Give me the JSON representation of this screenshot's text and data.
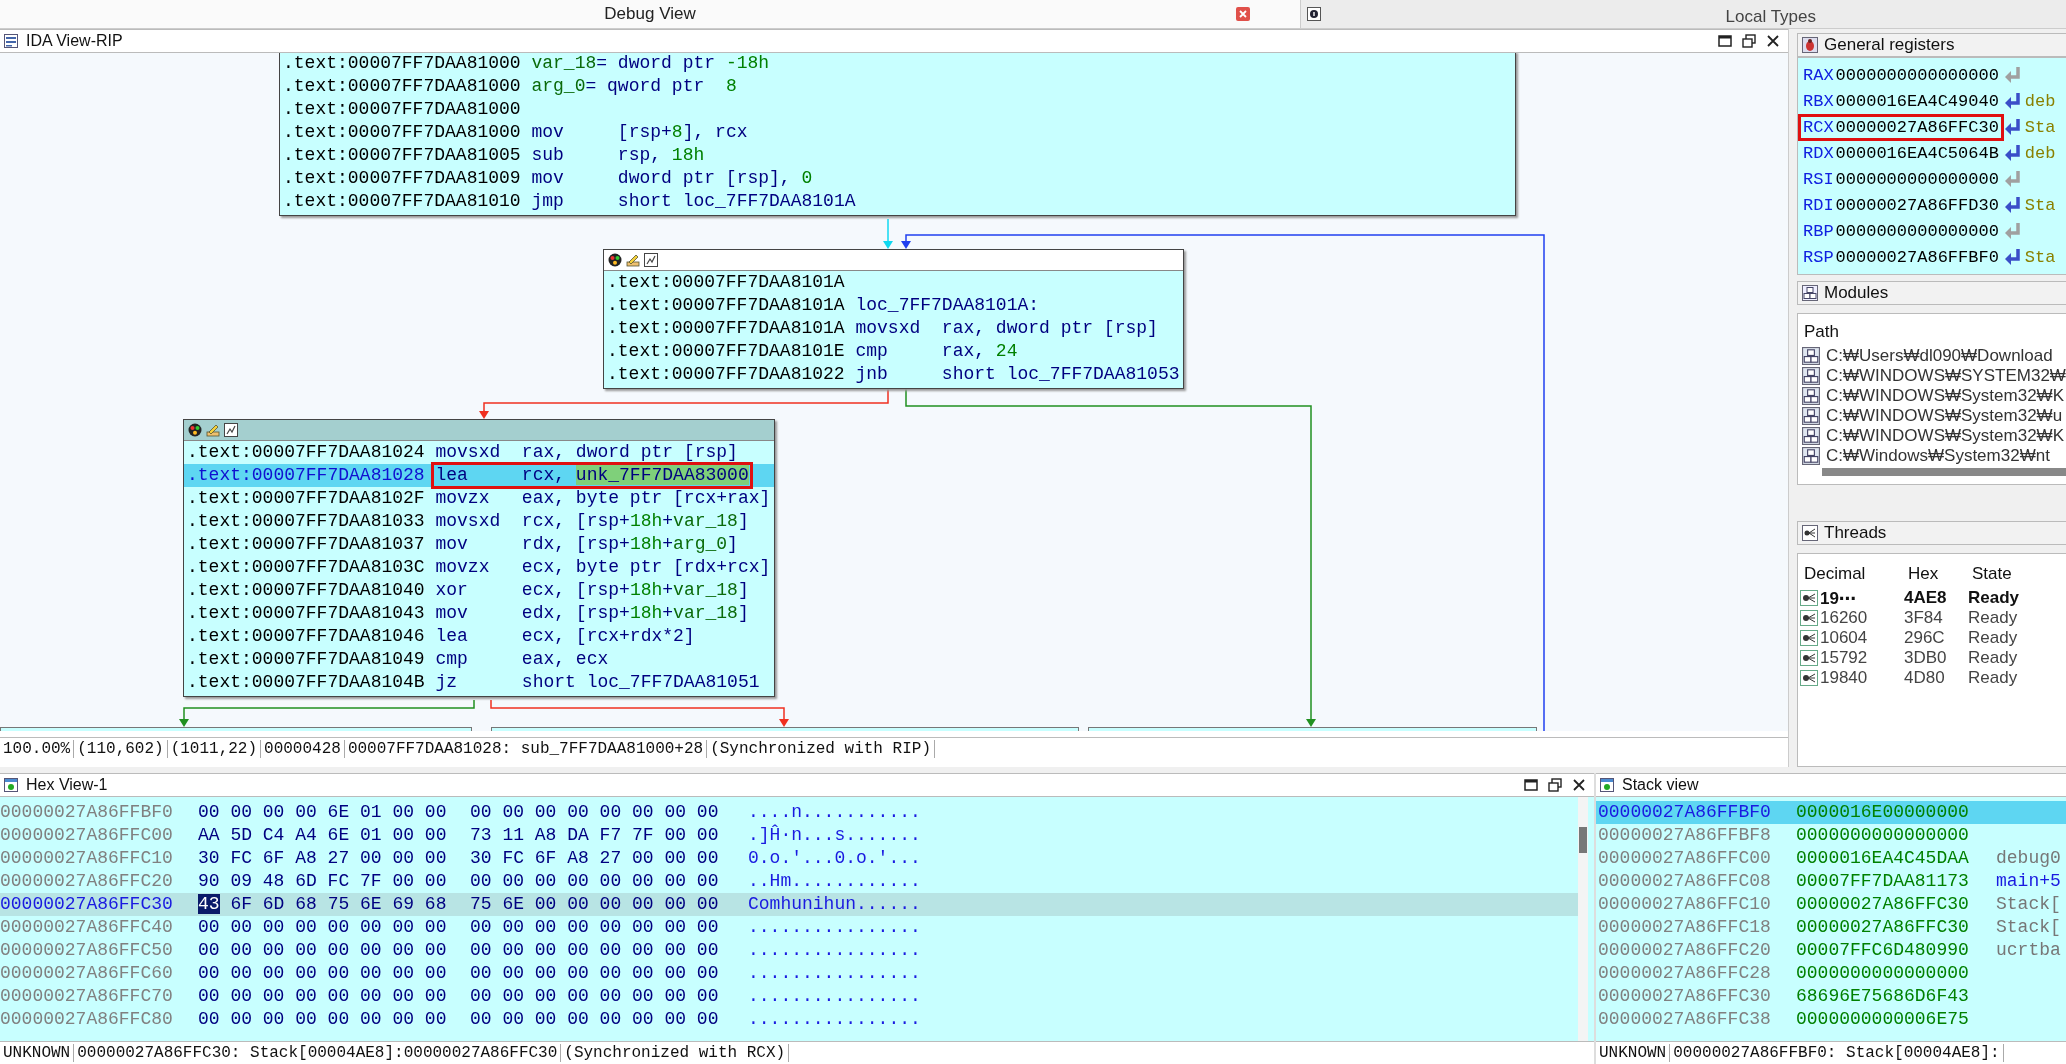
{
  "top_tabs": [
    {
      "label": "Debug View",
      "selected": true
    },
    {
      "label": "Local Types",
      "selected": false
    }
  ],
  "ida_view": {
    "title": "IDA View-RIP",
    "blocks": [
      {
        "header": false,
        "lines": [
          {
            "address": ".text:00007FF7DAA81000",
            "ops": [
              {
                "t": "var_18",
                "kind": "var"
              },
              {
                "t": "= dword ptr ",
                "kind": "op"
              },
              {
                "t": "-18h",
                "kind": "num"
              }
            ],
            "selected": false,
            "boxed": false
          },
          {
            "address": ".text:00007FF7DAA81000",
            "ops": [
              {
                "t": "arg_0",
                "kind": "var"
              },
              {
                "t": "= qword ptr  ",
                "kind": "op"
              },
              {
                "t": "8",
                "kind": "num"
              }
            ],
            "selected": false,
            "boxed": false
          },
          {
            "address": ".text:00007FF7DAA81000",
            "selected": false,
            "boxed": false
          },
          {
            "address": ".text:00007FF7DAA81000",
            "mnemonic": "mov",
            "ops": [
              {
                "t": "[rsp+",
                "kind": "op"
              },
              {
                "t": "8",
                "kind": "num"
              },
              {
                "t": "], rcx",
                "kind": "op"
              }
            ],
            "selected": false,
            "boxed": false
          },
          {
            "address": ".text:00007FF7DAA81005",
            "mnemonic": "sub",
            "ops": [
              {
                "t": "rsp, ",
                "kind": "op"
              },
              {
                "t": "18h",
                "kind": "num"
              }
            ],
            "selected": false,
            "boxed": false
          },
          {
            "address": ".text:00007FF7DAA81009",
            "mnemonic": "mov",
            "ops": [
              {
                "t": "dword ptr [rsp], ",
                "kind": "op"
              },
              {
                "t": "0",
                "kind": "num"
              }
            ],
            "selected": false,
            "boxed": false
          },
          {
            "address": ".text:00007FF7DAA81010",
            "mnemonic": "jmp",
            "ops": [
              {
                "t": "short loc_7FF7DAA8101A",
                "kind": "op"
              }
            ],
            "selected": false,
            "boxed": false
          }
        ]
      },
      {
        "header": true,
        "active": false,
        "lines": [
          {
            "address": ".text:00007FF7DAA8101A",
            "selected": false,
            "boxed": false
          },
          {
            "address": ".text:00007FF7DAA8101A",
            "ops": [
              {
                "t": "loc_7FF7DAA8101A:",
                "kind": "op"
              }
            ],
            "selected": false,
            "boxed": false
          },
          {
            "address": ".text:00007FF7DAA8101A",
            "mnemonic": "movsxd",
            "ops": [
              {
                "t": "rax, dword ptr [rsp]",
                "kind": "op"
              }
            ],
            "selected": false,
            "boxed": false
          },
          {
            "address": ".text:00007FF7DAA8101E",
            "mnemonic": "cmp",
            "ops": [
              {
                "t": "rax, ",
                "kind": "op"
              },
              {
                "t": "24",
                "kind": "num"
              }
            ],
            "selected": false,
            "boxed": false
          },
          {
            "address": ".text:00007FF7DAA81022",
            "mnemonic": "jnb",
            "ops": [
              {
                "t": "short loc_7FF7DAA81053",
                "kind": "op"
              }
            ],
            "selected": false,
            "boxed": false
          }
        ]
      },
      {
        "header": true,
        "active": true,
        "lines": [
          {
            "address": ".text:00007FF7DAA81024",
            "mnemonic": "movsxd",
            "ops": [
              {
                "t": "rax, dword ptr [rsp]",
                "kind": "op"
              }
            ],
            "selected": false,
            "boxed": false
          },
          {
            "address": ".text:00007FF7DAA81028",
            "mnemonic": "lea",
            "ops": [
              {
                "t": "rcx, ",
                "kind": "op"
              },
              {
                "t": "unk_7FF7DAA83000",
                "kind": "hl"
              }
            ],
            "selected": true,
            "boxed": true
          },
          {
            "address": ".text:00007FF7DAA8102F",
            "mnemonic": "movzx",
            "ops": [
              {
                "t": "eax, byte ptr [rcx+rax]",
                "kind": "op"
              }
            ],
            "selected": false,
            "boxed": false
          },
          {
            "address": ".text:00007FF7DAA81033",
            "mnemonic": "movsxd",
            "ops": [
              {
                "t": "rcx, [rsp+",
                "kind": "op"
              },
              {
                "t": "18h",
                "kind": "num"
              },
              {
                "t": "+",
                "kind": "op"
              },
              {
                "t": "var_18",
                "kind": "var"
              },
              {
                "t": "]",
                "kind": "op"
              }
            ],
            "selected": false,
            "boxed": false
          },
          {
            "address": ".text:00007FF7DAA81037",
            "mnemonic": "mov",
            "ops": [
              {
                "t": "rdx, [rsp+",
                "kind": "op"
              },
              {
                "t": "18h",
                "kind": "num"
              },
              {
                "t": "+",
                "kind": "op"
              },
              {
                "t": "arg_0",
                "kind": "var"
              },
              {
                "t": "]",
                "kind": "op"
              }
            ],
            "selected": false,
            "boxed": false
          },
          {
            "address": ".text:00007FF7DAA8103C",
            "mnemonic": "movzx",
            "ops": [
              {
                "t": "ecx, byte ptr [rdx+rcx]",
                "kind": "op"
              }
            ],
            "selected": false,
            "boxed": false
          },
          {
            "address": ".text:00007FF7DAA81040",
            "mnemonic": "xor",
            "ops": [
              {
                "t": "ecx, [rsp+",
                "kind": "op"
              },
              {
                "t": "18h",
                "kind": "num"
              },
              {
                "t": "+",
                "kind": "op"
              },
              {
                "t": "var_18",
                "kind": "var"
              },
              {
                "t": "]",
                "kind": "op"
              }
            ],
            "selected": false,
            "boxed": false
          },
          {
            "address": ".text:00007FF7DAA81043",
            "mnemonic": "mov",
            "ops": [
              {
                "t": "edx, [rsp+",
                "kind": "op"
              },
              {
                "t": "18h",
                "kind": "num"
              },
              {
                "t": "+",
                "kind": "op"
              },
              {
                "t": "var_18",
                "kind": "var"
              },
              {
                "t": "]",
                "kind": "op"
              }
            ],
            "selected": false,
            "boxed": false
          },
          {
            "address": ".text:00007FF7DAA81046",
            "mnemonic": "lea",
            "ops": [
              {
                "t": "ecx, [rcx+rdx*2]",
                "kind": "op"
              }
            ],
            "selected": false,
            "boxed": false
          },
          {
            "address": ".text:00007FF7DAA81049",
            "mnemonic": "cmp",
            "ops": [
              {
                "t": "eax, ecx",
                "kind": "op"
              }
            ],
            "selected": false,
            "boxed": false
          },
          {
            "address": ".text:00007FF7DAA8104B",
            "mnemonic": "jz",
            "ops": [
              {
                "t": "short loc_7FF7DAA81051",
                "kind": "op"
              }
            ],
            "selected": false,
            "boxed": false
          }
        ]
      }
    ],
    "status": [
      "100.00%",
      "(110,602)",
      "(1011,22)",
      "00000428",
      "00007FF7DAA81028: sub_7FF7DAA81000+28",
      "(Synchronized with RIP)"
    ]
  },
  "registers": {
    "title": "General registers",
    "rows": [
      {
        "name": "RAX",
        "value": "0000000000000000",
        "active": false,
        "boxed": false
      },
      {
        "name": "RBX",
        "value": "0000016EA4C49040",
        "active": true,
        "note": "deb",
        "boxed": false
      },
      {
        "name": "RCX",
        "value": "00000027A86FFC30",
        "active": true,
        "note": "Sta",
        "boxed": true
      },
      {
        "name": "RDX",
        "value": "0000016EA4C5064B",
        "active": true,
        "note": "deb",
        "boxed": false
      },
      {
        "name": "RSI",
        "value": "0000000000000000",
        "active": false,
        "boxed": false
      },
      {
        "name": "RDI",
        "value": "00000027A86FFD30",
        "active": true,
        "note": "Sta",
        "boxed": false
      },
      {
        "name": "RBP",
        "value": "0000000000000000",
        "active": false,
        "boxed": false
      },
      {
        "name": "RSP",
        "value": "00000027A86FFBF0",
        "active": true,
        "note": "Sta",
        "boxed": false
      }
    ]
  },
  "modules": {
    "title": "Modules",
    "column": "Path",
    "rows": [
      "C:₩Users₩dl090₩Download",
      "C:₩WINDOWS₩SYSTEM32₩",
      "C:₩WINDOWS₩System32₩K",
      "C:₩WINDOWS₩System32₩u",
      "C:₩WINDOWS₩System32₩K",
      "C:₩Windows₩System32₩nt"
    ]
  },
  "threads": {
    "title": "Threads",
    "columns": [
      "Decimal",
      "Hex",
      "State"
    ],
    "rows": [
      {
        "decimal": "19⋯",
        "hex": "4AE8",
        "state": "Ready",
        "current": true
      },
      {
        "decimal": "16260",
        "hex": "3F84",
        "state": "Ready",
        "current": false
      },
      {
        "decimal": "10604",
        "hex": "296C",
        "state": "Ready",
        "current": false
      },
      {
        "decimal": "15792",
        "hex": "3DB0",
        "state": "Ready",
        "current": false
      },
      {
        "decimal": "19840",
        "hex": "4D80",
        "state": "Ready",
        "current": false
      }
    ]
  },
  "hex_view": {
    "title": "Hex View-1",
    "rows": [
      {
        "address": "00000027A86FFBF0",
        "bytes_1": "00 00 00 00 6E 01 00 00",
        "bytes_2": "00 00 00 00 00 00 00 00",
        "ascii": "....n...........",
        "selected": false
      },
      {
        "address": "00000027A86FFC00",
        "bytes_1": "AA 5D C4 A4 6E 01 00 00",
        "bytes_2": "73 11 A8 DA F7 7F 00 00",
        "ascii": ".]Ĥ·n...s.......",
        "selected": false
      },
      {
        "address": "00000027A86FFC10",
        "bytes_1": "30 FC 6F A8 27 00 00 00",
        "bytes_2": "30 FC 6F A8 27 00 00 00",
        "ascii": "0.o.'...0.o.'...",
        "selected": false
      },
      {
        "address": "00000027A86FFC20",
        "bytes_1": "90 09 48 6D FC 7F 00 00",
        "bytes_2": "00 00 00 00 00 00 00 00",
        "ascii": "..Hm............",
        "selected": false
      },
      {
        "address": "00000027A86FFC30",
        "cursor_byte": "43",
        "bytes_1": "6F 6D 68 75 6E 69 68",
        "bytes_2": "75 6E 00 00 00 00 00 00",
        "ascii": "Comhunihun......",
        "selected": true
      },
      {
        "address": "00000027A86FFC40",
        "bytes_1": "00 00 00 00 00 00 00 00",
        "bytes_2": "00 00 00 00 00 00 00 00",
        "ascii": "................",
        "selected": false
      },
      {
        "address": "00000027A86FFC50",
        "bytes_1": "00 00 00 00 00 00 00 00",
        "bytes_2": "00 00 00 00 00 00 00 00",
        "ascii": "................",
        "selected": false
      },
      {
        "address": "00000027A86FFC60",
        "bytes_1": "00 00 00 00 00 00 00 00",
        "bytes_2": "00 00 00 00 00 00 00 00",
        "ascii": "................",
        "selected": false
      },
      {
        "address": "00000027A86FFC70",
        "bytes_1": "00 00 00 00 00 00 00 00",
        "bytes_2": "00 00 00 00 00 00 00 00",
        "ascii": "................",
        "selected": false
      },
      {
        "address": "00000027A86FFC80",
        "bytes_1": "00 00 00 00 00 00 00 00",
        "bytes_2": "00 00 00 00 00 00 00 00",
        "ascii": "................",
        "selected": false
      }
    ],
    "status": [
      "UNKNOWN",
      "00000027A86FFC30: Stack[00004AE8]:00000027A86FFC30",
      "(Synchronized with RCX)"
    ]
  },
  "stack_view": {
    "title": "Stack view",
    "rows": [
      {
        "address": "00000027A86FFBF0",
        "value": "0000016E00000000",
        "selected": true
      },
      {
        "address": "00000027A86FFBF8",
        "value": "0000000000000000",
        "selected": false
      },
      {
        "address": "00000027A86FFC00",
        "value": "0000016EA4C45DAA",
        "note": "debug0",
        "kind": "data",
        "selected": false
      },
      {
        "address": "00000027A86FFC08",
        "value": "00007FF7DAA81173",
        "note": "main+5",
        "kind": "code",
        "selected": false
      },
      {
        "address": "00000027A86FFC10",
        "value": "00000027A86FFC30",
        "note": "Stack[",
        "kind": "data",
        "selected": false
      },
      {
        "address": "00000027A86FFC18",
        "value": "00000027A86FFC30",
        "note": "Stack[",
        "kind": "data",
        "selected": false
      },
      {
        "address": "00000027A86FFC20",
        "value": "00007FFC6D480990",
        "note": "ucrtba",
        "kind": "data",
        "selected": false
      },
      {
        "address": "00000027A86FFC28",
        "value": "0000000000000000",
        "selected": false
      },
      {
        "address": "00000027A86FFC30",
        "value": "68696E75686D6F43",
        "selected": false
      },
      {
        "address": "00000027A86FFC38",
        "value": "0000000000006E75",
        "selected": false
      }
    ],
    "status": [
      "UNKNOWN",
      "00000027A86FFBF0: Stack[00004AE8]:"
    ]
  }
}
